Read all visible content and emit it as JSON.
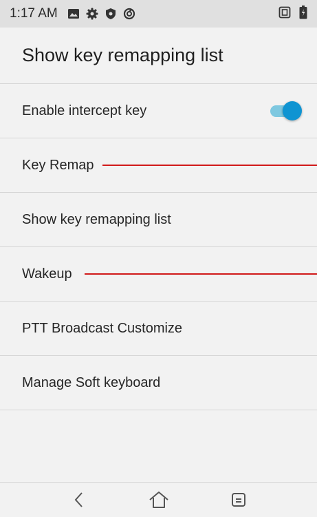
{
  "status_bar": {
    "time": "1:17 AM",
    "icons": [
      "image-icon",
      "settings-icon",
      "shield-icon",
      "data-saver-icon"
    ],
    "right_icons": [
      "nfc-icon",
      "battery-icon"
    ]
  },
  "header": {
    "title": "Show key remapping list"
  },
  "settings": {
    "items": [
      {
        "label": "Enable intercept key",
        "toggle_on": true
      },
      {
        "label": "Key Remap"
      },
      {
        "label": "Show key remapping list"
      },
      {
        "label": "Wakeup"
      },
      {
        "label": "PTT Broadcast Customize"
      },
      {
        "label": "Manage Soft keyboard"
      }
    ]
  },
  "nav_bar": {
    "buttons": [
      "back-icon",
      "home-icon",
      "recents-icon"
    ]
  },
  "colors": {
    "toggle_thumb": "#0f94d2",
    "toggle_track": "#7ec8e0",
    "annotation_line": "#d11a1a",
    "status_bar_bg": "#e0e0e0",
    "background": "#f2f2f2"
  }
}
